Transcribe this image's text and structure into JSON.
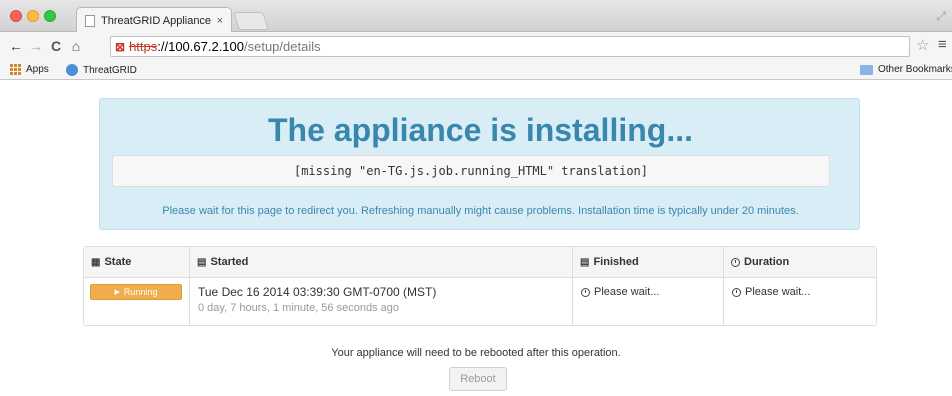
{
  "browser": {
    "tab_title": "ThreatGRID Appliance Adm",
    "tab_close": "×",
    "url_scheme": "https",
    "url_host": "://100.67.2.100",
    "url_path": "/setup/details",
    "bookmarks": {
      "apps": "Apps",
      "threatgrid": "ThreatGRID",
      "other": "Other Bookmarks"
    }
  },
  "alert": {
    "heading": "The appliance is installing...",
    "code": "[missing \"en-TG.js.job.running_HTML\" translation]",
    "note": "Please wait for this page to redirect you. Refreshing manually might cause problems. Installation time is typically under 20 minutes."
  },
  "table": {
    "headers": {
      "state": "State",
      "started": "Started",
      "finished": "Finished",
      "duration": "Duration"
    },
    "row": {
      "status": "Running",
      "started_date": "Tue Dec 16 2014 03:39:30 GMT-0700 (MST)",
      "started_ago": "0 day, 7 hours, 1 minute, 56 seconds ago",
      "finished": "Please wait...",
      "duration": "Please wait..."
    }
  },
  "footer": {
    "reboot_note": "Your appliance will need to be rebooted after this operation.",
    "reboot_label": "Reboot"
  },
  "colors": {
    "alert_bg": "#d9edf7",
    "alert_text": "#3a87ad",
    "running_badge": "#f0ad4e"
  },
  "icons": {
    "state": "grid-icon",
    "started": "calendar-icon",
    "finished": "calendar-icon",
    "duration": "clock-icon"
  }
}
